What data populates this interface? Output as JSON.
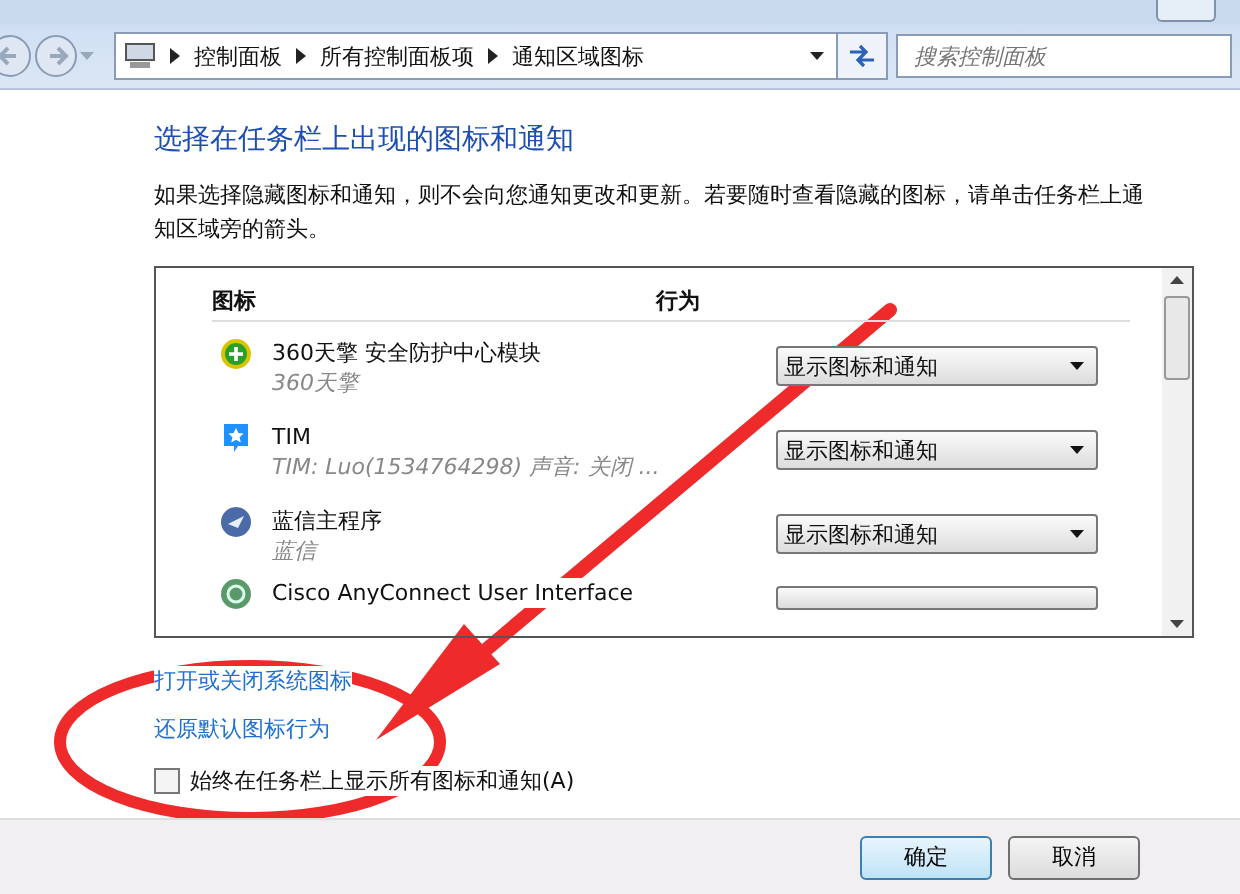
{
  "address_bar": {
    "breadcrumbs": [
      "控制面板",
      "所有控制面板项",
      "通知区域图标"
    ]
  },
  "search": {
    "placeholder": "搜索控制面板"
  },
  "heading": "选择在任务栏上出现的图标和通知",
  "description": "如果选择隐藏图标和通知，则不会向您通知更改和更新。若要随时查看隐藏的图标，请单击任务栏上通知区域旁的箭头。",
  "table": {
    "columns": [
      "图标",
      "行为"
    ],
    "rows": [
      {
        "kind": "shield",
        "name": "360天擎 安全防护中心模块",
        "detail": "360天擎",
        "behavior": "显示图标和通知"
      },
      {
        "kind": "chat",
        "name": "TIM",
        "detail": "TIM: Luo(1534764298)  声音: 关闭 ...",
        "behavior": "显示图标和通知"
      },
      {
        "kind": "bird",
        "name": "蓝信主程序",
        "detail": "蓝信",
        "behavior": "显示图标和通知"
      },
      {
        "kind": "globe",
        "name": "Cisco AnyConnect User Interface",
        "detail": "",
        "behavior": ""
      }
    ]
  },
  "links": [
    "打开或关闭系统图标",
    "还原默认图标行为"
  ],
  "always_show": {
    "label": "始终在任务栏上显示所有图标和通知(A)",
    "checked": false
  },
  "buttons": [
    "确定",
    "取消"
  ]
}
